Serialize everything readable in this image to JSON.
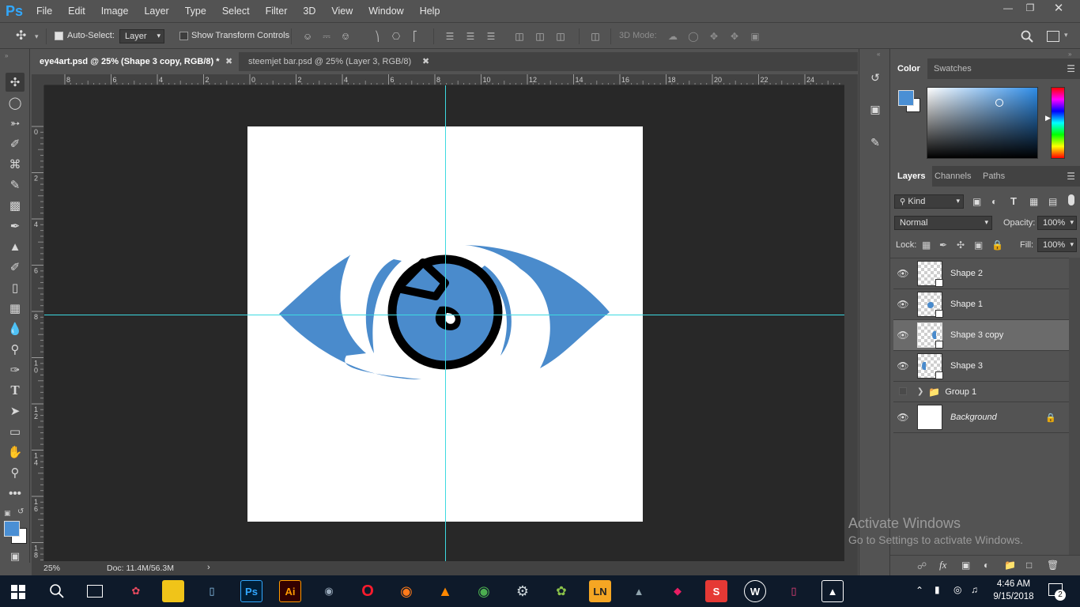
{
  "app": {
    "logo": "Ps",
    "menu": [
      "File",
      "Edit",
      "Image",
      "Layer",
      "Type",
      "Select",
      "Filter",
      "3D",
      "View",
      "Window",
      "Help"
    ],
    "window_controls": [
      "minimize-icon",
      "restore-icon",
      "close-icon"
    ]
  },
  "options": {
    "auto_select_label": "Auto-Select:",
    "auto_select_checked": true,
    "auto_select_target": "Layer",
    "show_transform_label": "Show Transform Controls",
    "show_transform_checked": false,
    "mode_3d_label": "3D Mode:"
  },
  "tabs": [
    {
      "label": "eye4art.psd @ 25% (Shape 3 copy, RGB/8) *",
      "active": true
    },
    {
      "label": "steemjet bar.psd @ 25% (Layer 3, RGB/8)",
      "active": false
    }
  ],
  "rulers": {
    "top": [
      "8",
      "6",
      "4",
      "2",
      "0",
      "2",
      "4",
      "6",
      "8",
      "10",
      "12",
      "14",
      "16",
      "18",
      "20",
      "22",
      "24"
    ],
    "left": [
      "0",
      "2",
      "4",
      "6",
      "8",
      "1 0",
      "1 2",
      "1 4",
      "1 6",
      "1 8"
    ]
  },
  "status": {
    "zoom": "25%",
    "doc": "Doc: 11.4M/56.3M"
  },
  "colors": {
    "foreground": "#4a8fd4",
    "background": "#ffffff",
    "eye_blue": "#4a8bcc",
    "guide": "#3dd9e0"
  },
  "color_panel": {
    "tabs": [
      "Color",
      "Swatches"
    ]
  },
  "layers_panel": {
    "tabs": [
      "Layers",
      "Channels",
      "Paths"
    ],
    "filter_kind": "Kind",
    "blend_mode": "Normal",
    "opacity_label": "Opacity:",
    "opacity_value": "100%",
    "lock_label": "Lock:",
    "fill_label": "Fill:",
    "fill_value": "100%",
    "layers": [
      {
        "name": "Shape 2",
        "visible": true,
        "selected": false
      },
      {
        "name": "Shape 1",
        "visible": true,
        "selected": false
      },
      {
        "name": "Shape 3 copy",
        "visible": true,
        "selected": true
      },
      {
        "name": "Shape 3",
        "visible": true,
        "selected": false
      },
      {
        "name": "Group 1",
        "visible": false,
        "selected": false
      },
      {
        "name": "Background",
        "visible": true,
        "selected": false
      }
    ]
  },
  "watermark": {
    "title": "Activate Windows",
    "subtitle": "Go to Settings to activate Windows."
  },
  "taskbar": {
    "time": "4:46 AM",
    "date": "9/15/2018",
    "notifications": "2"
  }
}
